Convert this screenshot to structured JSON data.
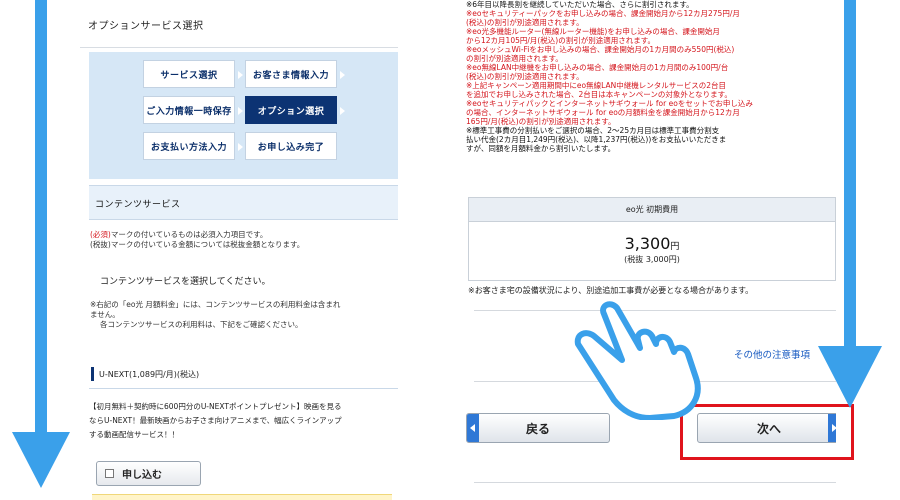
{
  "left": {
    "header_title": "オプションサービス選択",
    "steps": [
      {
        "label": "サービス選択",
        "active": false
      },
      {
        "label": "お客さま情報入力",
        "active": false
      },
      {
        "label": "ご入力情報一時保存",
        "active": false
      },
      {
        "label": "オプション選択",
        "active": true
      },
      {
        "label": "お支払い方法入力",
        "active": false
      },
      {
        "label": "お申し込み完了",
        "active": false
      }
    ],
    "section_title": "コンテンツサービス",
    "required_note_mark": "(必須)",
    "required_note_text": "マークの付いているものは必須入力項目です。",
    "tax_note": "(税抜)マークの付いている金額については税抜金額となります。",
    "select_message": "コンテンツサービスを選択してください。",
    "monthly_note_1": "※右記の「eo光 月額料金」には、コンテンツサービスの利用料金は含まれ",
    "monthly_note_2": "ません。",
    "monthly_note_3": "各コンテンツサービスの利用料は、下記をご確認ください。",
    "service_title": "U-NEXT(1,089円/月)(税込)",
    "service_desc_1": "【初月無料＋契約時に600円分のU-NEXTポイントプレゼント】映画を見る",
    "service_desc_2": "ならU-NEXT！最新映画からお子さま向けアニメまで、幅広くラインアップ",
    "service_desc_3": "する動画配信サービス！！",
    "apply_label": "申し込む"
  },
  "right": {
    "notes": [
      {
        "text": "※6年目以降長割を継続していただいた場合、さらに割引されます。",
        "red": false
      },
      {
        "text": "※eoセキュリティーパックをお申し込みの場合、課金開始月から12カ月275円/月",
        "red": true
      },
      {
        "text": "(税込)の割引が別途適用されます。",
        "red": true
      },
      {
        "text": "※eo光多機能ルーター(無線ルーター機能)をお申し込みの場合、課金開始月",
        "red": true
      },
      {
        "text": "から12カ月105円/月(税込)の割引が別途適用されます。",
        "red": true
      },
      {
        "text": "※eoメッシュWi-Fiをお申し込みの場合、課金開始月の1カ月間のみ550円(税込)",
        "red": true
      },
      {
        "text": "の割引が別途適用されます。",
        "red": true
      },
      {
        "text": "※eo無線LAN中継機をお申し込みの場合、課金開始月の1カ月間のみ100円/台",
        "red": true
      },
      {
        "text": "(税込)の割引が別途適用されます。",
        "red": true
      },
      {
        "text": "※上記キャンペーン適用期間中にeo無線LAN中継機レンタルサービスの2台目",
        "red": true
      },
      {
        "text": "を追加でお申し込みされた場合、2台目は本キャンペーンの対象外となります。",
        "red": true
      },
      {
        "text": "※eoセキュリティパックとインターネットサギウォール for eoをセットでお申し込み",
        "red": true
      },
      {
        "text": "の場合、インターネットサギウォール for eoの月額料金を課金開始月から12カ月",
        "red": true
      },
      {
        "text": "165円/月(税込)の割引が別途適用されます。",
        "red": true
      },
      {
        "text": "※標準工事費の分割払いをご選択の場合、2～25カ月目は標準工事費分割支",
        "red": false
      },
      {
        "text": "払い代金(2カ月目1,249円(税込)、以降1,237円(税込))をお支払いいただきま",
        "red": false
      },
      {
        "text": "すが、同額を月額料金から割引いたします。",
        "red": false
      }
    ],
    "fee_title": "eo光 初期費用",
    "fee_amount": "3,300",
    "fee_unit": "円",
    "fee_tax": "(税抜 3,000円)",
    "fee_note": "※お客さま宅の設備状況により、別途追加工事費が必要となる場合があります。",
    "other_link": "その他の注意事項",
    "back_label": "戻る",
    "next_label": "次へ"
  },
  "colors": {
    "arrow": "#3aa0ea",
    "active_step": "#0c3373",
    "highlight": "#e0141c",
    "notice_red": "#d4151c"
  },
  "icons": [
    "scroll-down-arrow-icon",
    "pointing-hand-icon",
    "checkbox-icon",
    "chevron-left-icon",
    "chevron-right-icon"
  ]
}
